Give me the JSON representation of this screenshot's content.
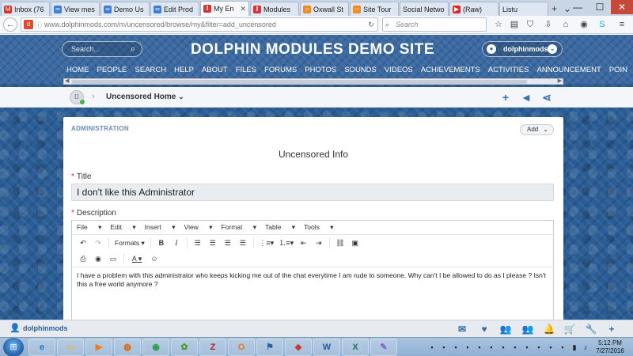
{
  "browser": {
    "tabs": [
      {
        "label": "Inbox (76",
        "icon": "gmail-icon",
        "color": "#d93025",
        "glyph": "M"
      },
      {
        "label": "View mes",
        "icon": "dolphin-icon",
        "color": "#3b7dd8",
        "glyph": "∞"
      },
      {
        "label": "Demo Us",
        "icon": "dolphin-icon",
        "color": "#3b7dd8",
        "glyph": "∞"
      },
      {
        "label": "Edit Prod",
        "icon": "dolphin-icon",
        "color": "#3b7dd8",
        "glyph": "∞"
      },
      {
        "label": "My En",
        "icon": "una-icon",
        "color": "#d9333a",
        "glyph": "‖",
        "active": true
      },
      {
        "label": "Modules",
        "icon": "una-icon",
        "color": "#d9333a",
        "glyph": "‖"
      },
      {
        "label": "Oxwall St",
        "icon": "oxwall-icon",
        "color": "#f08a24",
        "glyph": "○"
      },
      {
        "label": "Site Tour",
        "icon": "site-tour-icon",
        "color": "#f08a24",
        "glyph": "○"
      },
      {
        "label": "Social Netwo",
        "icon": "",
        "color": "",
        "glyph": ""
      },
      {
        "label": "(Raw)",
        "icon": "youtube-icon",
        "color": "#e62117",
        "glyph": "▶"
      },
      {
        "label": "Listu",
        "icon": "",
        "color": "",
        "glyph": ""
      }
    ],
    "new_tab_glyph": "+",
    "tab_list_glyph": "⌄",
    "window_controls": [
      "—",
      "☐",
      "✕"
    ],
    "url": "www.dolphinmods.com/m/uncensored/browse/my&filter=add_uncensored",
    "search_placeholder": "Search",
    "brand_color": "#3b6aa2"
  },
  "site": {
    "search_placeholder": "Search...",
    "title": "DOLPHIN MODULES DEMO SITE",
    "username": "dolphinmods",
    "menu": [
      "HOME",
      "PEOPLE",
      "SEARCH",
      "HELP",
      "ABOUT",
      "FILES",
      "FORUMS",
      "PHOTOS",
      "SOUNDS",
      "VIDEOS",
      "ACHIEVEMENTS",
      "ACTIVITIES",
      "ANNOUNCEMENT",
      "POIN"
    ],
    "breadcrumb": "Uncensored Home",
    "accent_color": "#2f6fb2"
  },
  "card": {
    "section_label": "ADMINISTRATION",
    "add_label": "Add",
    "form_title": "Uncensored Info",
    "title_label": "Title",
    "title_value": "I don't like this Administrator",
    "description_label": "Description",
    "required_mark": "*"
  },
  "editor": {
    "menus": [
      "File",
      "Edit",
      "Insert",
      "View",
      "Format",
      "Table",
      "Tools"
    ],
    "formats_label": "Formats",
    "body": "I have a problem with this administrator who keeps kicking me out of the chat everytime I am rude to someone. Why can't I be allowed to do as I please ? Isn't this a free world anymore ?"
  },
  "bottom_bar": {
    "username": "dolphinmods"
  },
  "taskbar": {
    "apps": [
      "ie-icon",
      "explorer-icon",
      "media-player-icon",
      "firefox-icon",
      "chrome-icon",
      "frog-icon",
      "filezilla-icon",
      "outlook-icon",
      "network-icon",
      "eraser-icon",
      "word-icon",
      "excel-icon",
      "paint-icon"
    ],
    "time": "5:12 PM",
    "date": "7/27/2016"
  }
}
